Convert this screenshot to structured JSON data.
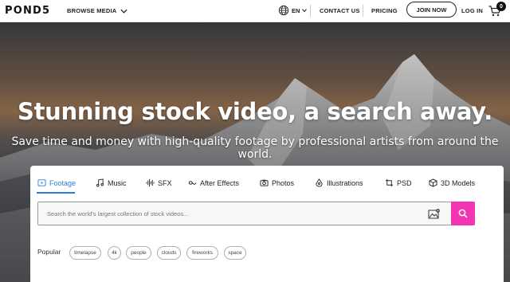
{
  "nav": {
    "logo": "POND5",
    "browse_label": "BROWSE MEDIA",
    "lang_label": "EN",
    "contact_label": "CONTACT US",
    "pricing_label": "PRICING",
    "join_label": "JOIN NOW",
    "login_label": "LOG IN",
    "cart_count": "0"
  },
  "hero": {
    "headline": "Stunning stock video, a search away.",
    "subline": "Save time and money with high-quality footage by professional artists from around the world."
  },
  "tabs": [
    {
      "label": "Footage",
      "icon": "footage-icon",
      "active": true
    },
    {
      "label": "Music",
      "icon": "music-icon"
    },
    {
      "label": "SFX",
      "icon": "sfx-icon"
    },
    {
      "label": "After Effects",
      "icon": "after-effects-icon"
    },
    {
      "label": "Photos",
      "icon": "camera-icon"
    },
    {
      "label": "Illustrations",
      "icon": "illustrations-icon"
    },
    {
      "label": "PSD",
      "icon": "psd-icon"
    },
    {
      "label": "3D Models",
      "icon": "cube-icon"
    }
  ],
  "search": {
    "placeholder": "Search the world's largest collection of stock videos...",
    "value": ""
  },
  "popular": {
    "label": "Popular",
    "chips": [
      "timelapse",
      "4k",
      "people",
      "clouds",
      "fireworks",
      "space"
    ]
  },
  "colors": {
    "accent_blue": "#2a7fd4",
    "search_pink": "#f236b3",
    "text_dark": "#222222"
  }
}
